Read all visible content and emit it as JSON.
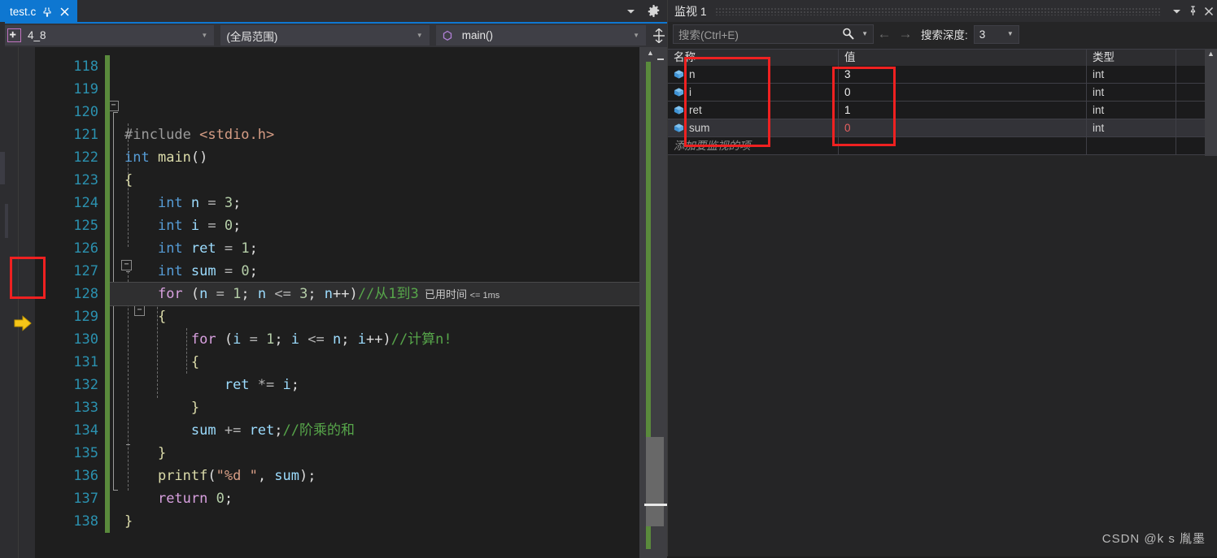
{
  "editor": {
    "tab": {
      "title": "test.c",
      "pin_icon": "pin-icon",
      "close_icon": "close-icon"
    },
    "tabstrip_right": {
      "dropdown_icon": "chevron-down-icon",
      "settings_icon": "gear-icon"
    },
    "navbar": {
      "project": "4_8",
      "project_icon": "project-icon",
      "scope": "(全局范围)",
      "member": "main()",
      "member_icon": "method-icon",
      "split_icon": "split-view-icon",
      "dropdown_icon": "chevron-down-icon"
    },
    "exec_marker": "execution-pointer-icon",
    "elapsed_time": "已用时间 <= 1ms",
    "lines": [
      {
        "no": "118",
        "tokens": []
      },
      {
        "no": "119",
        "tokens": []
      },
      {
        "no": "120",
        "tokens": []
      },
      {
        "no": "121",
        "tokens": [
          {
            "t": "#include ",
            "c": "tok-pre"
          },
          {
            "t": "<stdio.h>",
            "c": "tok-inc"
          }
        ]
      },
      {
        "no": "122",
        "tokens": [
          {
            "t": "int",
            "c": "tok-kw"
          },
          {
            "t": " ",
            "c": "tok-plain"
          },
          {
            "t": "main",
            "c": "tok-fn"
          },
          {
            "t": "()",
            "c": "tok-plain"
          }
        ]
      },
      {
        "no": "123",
        "tokens": [
          {
            "t": "{",
            "c": "tok-brace"
          }
        ]
      },
      {
        "no": "124",
        "tokens": [
          {
            "t": "    ",
            "c": "tok-plain"
          },
          {
            "t": "int",
            "c": "tok-kw"
          },
          {
            "t": " ",
            "c": "tok-plain"
          },
          {
            "t": "n",
            "c": "tok-id"
          },
          {
            "t": " = ",
            "c": "tok-op"
          },
          {
            "t": "3",
            "c": "tok-num"
          },
          {
            "t": ";",
            "c": "tok-plain"
          }
        ]
      },
      {
        "no": "125",
        "tokens": [
          {
            "t": "    ",
            "c": "tok-plain"
          },
          {
            "t": "int",
            "c": "tok-kw"
          },
          {
            "t": " ",
            "c": "tok-plain"
          },
          {
            "t": "i",
            "c": "tok-id"
          },
          {
            "t": " = ",
            "c": "tok-op"
          },
          {
            "t": "0",
            "c": "tok-num"
          },
          {
            "t": ";",
            "c": "tok-plain"
          }
        ]
      },
      {
        "no": "126",
        "tokens": [
          {
            "t": "    ",
            "c": "tok-plain"
          },
          {
            "t": "int",
            "c": "tok-kw"
          },
          {
            "t": " ",
            "c": "tok-plain"
          },
          {
            "t": "ret",
            "c": "tok-id"
          },
          {
            "t": " = ",
            "c": "tok-op"
          },
          {
            "t": "1",
            "c": "tok-num"
          },
          {
            "t": ";",
            "c": "tok-plain"
          }
        ]
      },
      {
        "no": "127",
        "tokens": [
          {
            "t": "    ",
            "c": "tok-plain"
          },
          {
            "t": "int",
            "c": "tok-kw"
          },
          {
            "t": " ",
            "c": "tok-plain"
          },
          {
            "t": "sum",
            "c": "tok-id"
          },
          {
            "t": " = ",
            "c": "tok-op"
          },
          {
            "t": "0",
            "c": "tok-num"
          },
          {
            "t": ";",
            "c": "tok-plain"
          }
        ]
      },
      {
        "no": "128",
        "current": true,
        "tokens": [
          {
            "t": "    ",
            "c": "tok-plain"
          },
          {
            "t": "for",
            "c": "tok-kw2"
          },
          {
            "t": " (",
            "c": "tok-plain"
          },
          {
            "t": "n",
            "c": "tok-id"
          },
          {
            "t": " = ",
            "c": "tok-op"
          },
          {
            "t": "1",
            "c": "tok-num"
          },
          {
            "t": "; ",
            "c": "tok-plain"
          },
          {
            "t": "n",
            "c": "tok-id"
          },
          {
            "t": " <= ",
            "c": "tok-op"
          },
          {
            "t": "3",
            "c": "tok-num"
          },
          {
            "t": "; ",
            "c": "tok-plain"
          },
          {
            "t": "n",
            "c": "tok-id"
          },
          {
            "t": "++)",
            "c": "tok-plain"
          },
          {
            "t": "//从1到3",
            "c": "tok-cmt"
          }
        ]
      },
      {
        "no": "129",
        "tokens": [
          {
            "t": "    ",
            "c": "tok-plain"
          },
          {
            "t": "{",
            "c": "tok-brace"
          }
        ]
      },
      {
        "no": "130",
        "tokens": [
          {
            "t": "        ",
            "c": "tok-plain"
          },
          {
            "t": "for",
            "c": "tok-kw2"
          },
          {
            "t": " (",
            "c": "tok-plain"
          },
          {
            "t": "i",
            "c": "tok-id"
          },
          {
            "t": " = ",
            "c": "tok-op"
          },
          {
            "t": "1",
            "c": "tok-num"
          },
          {
            "t": "; ",
            "c": "tok-plain"
          },
          {
            "t": "i",
            "c": "tok-id"
          },
          {
            "t": " <= ",
            "c": "tok-op"
          },
          {
            "t": "n",
            "c": "tok-id"
          },
          {
            "t": "; ",
            "c": "tok-plain"
          },
          {
            "t": "i",
            "c": "tok-id"
          },
          {
            "t": "++)",
            "c": "tok-plain"
          },
          {
            "t": "//计算n!",
            "c": "tok-cmt"
          }
        ]
      },
      {
        "no": "131",
        "tokens": [
          {
            "t": "        ",
            "c": "tok-plain"
          },
          {
            "t": "{",
            "c": "tok-brace"
          }
        ]
      },
      {
        "no": "132",
        "tokens": [
          {
            "t": "            ",
            "c": "tok-plain"
          },
          {
            "t": "ret",
            "c": "tok-id"
          },
          {
            "t": " *= ",
            "c": "tok-op"
          },
          {
            "t": "i",
            "c": "tok-id"
          },
          {
            "t": ";",
            "c": "tok-plain"
          }
        ]
      },
      {
        "no": "133",
        "tokens": [
          {
            "t": "        ",
            "c": "tok-plain"
          },
          {
            "t": "}",
            "c": "tok-brace"
          }
        ]
      },
      {
        "no": "134",
        "tokens": [
          {
            "t": "        ",
            "c": "tok-plain"
          },
          {
            "t": "sum",
            "c": "tok-id"
          },
          {
            "t": " += ",
            "c": "tok-op"
          },
          {
            "t": "ret",
            "c": "tok-id"
          },
          {
            "t": ";",
            "c": "tok-plain"
          },
          {
            "t": "//阶乘的和",
            "c": "tok-cmt"
          }
        ]
      },
      {
        "no": "135",
        "tokens": [
          {
            "t": "    ",
            "c": "tok-plain"
          },
          {
            "t": "}",
            "c": "tok-brace"
          }
        ]
      },
      {
        "no": "136",
        "tokens": [
          {
            "t": "    ",
            "c": "tok-plain"
          },
          {
            "t": "printf",
            "c": "tok-fn"
          },
          {
            "t": "(",
            "c": "tok-plain"
          },
          {
            "t": "\"%d \"",
            "c": "tok-str"
          },
          {
            "t": ", ",
            "c": "tok-plain"
          },
          {
            "t": "sum",
            "c": "tok-id"
          },
          {
            "t": ");",
            "c": "tok-plain"
          }
        ]
      },
      {
        "no": "137",
        "tokens": [
          {
            "t": "    ",
            "c": "tok-plain"
          },
          {
            "t": "return",
            "c": "tok-kw2"
          },
          {
            "t": " ",
            "c": "tok-plain"
          },
          {
            "t": "0",
            "c": "tok-num"
          },
          {
            "t": ";",
            "c": "tok-plain"
          }
        ]
      },
      {
        "no": "138",
        "tokens": [
          {
            "t": "}",
            "c": "tok-brace"
          }
        ]
      }
    ]
  },
  "watch": {
    "title": "监视 1",
    "dropdown_icon": "chevron-down-icon",
    "pin_icon": "pin-icon",
    "close_icon": "close-icon",
    "search_placeholder": "搜索(Ctrl+E)",
    "search_icon": "magnifier-icon",
    "search_options_icon": "chevron-down-icon",
    "prev_icon": "arrow-left-icon",
    "next_icon": "arrow-right-icon",
    "depth_label": "搜索深度:",
    "depth_value": "3",
    "columns": [
      "名称",
      "值",
      "类型"
    ],
    "rows": [
      {
        "name": "n",
        "value": "3",
        "type": "int",
        "changed": false,
        "selected": false
      },
      {
        "name": "i",
        "value": "0",
        "type": "int",
        "changed": false,
        "selected": false
      },
      {
        "name": "ret",
        "value": "1",
        "type": "int",
        "changed": false,
        "selected": false
      },
      {
        "name": "sum",
        "value": "0",
        "type": "int",
        "changed": true,
        "selected": true
      }
    ],
    "add_placeholder": "添加要监视的项",
    "row_icon": "variable-icon"
  },
  "watermark": "CSDN @k s 胤墨",
  "colors": {
    "accent_blue": "#0e77d1",
    "annotation_red": "#ef2121",
    "comment_green": "#57a64a",
    "changed_value": "#e86060",
    "change_bar_green": "#5a8a3c"
  }
}
